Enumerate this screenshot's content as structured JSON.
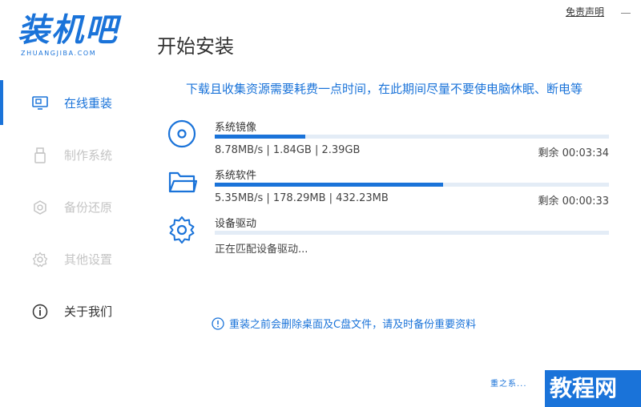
{
  "app": {
    "logo_text": "装机吧",
    "logo_sub": "ZHUANGJIBA.COM",
    "page_title": "开始安装",
    "disclaimer": "免责声明"
  },
  "sidebar": {
    "items": [
      {
        "label": "在线重装",
        "icon": "monitor-icon"
      },
      {
        "label": "制作系统",
        "icon": "usb-icon"
      },
      {
        "label": "备份还原",
        "icon": "backup-icon"
      },
      {
        "label": "其他设置",
        "icon": "gear-icon"
      },
      {
        "label": "关于我们",
        "icon": "info-icon"
      }
    ]
  },
  "notice": "下载且收集资源需要耗费一点时间，在此期间尽量不要使电脑休眠、断电等",
  "downloads": [
    {
      "title": "系统镜像",
      "stats": "8.78MB/s | 1.84GB | 2.39GB",
      "remaining": "剩余 00:03:34",
      "progress": 0.23,
      "icon": "disc-icon"
    },
    {
      "title": "系统软件",
      "stats": "5.35MB/s | 178.29MB | 432.23MB",
      "remaining": "剩余 00:00:33",
      "progress": 0.58,
      "icon": "folder-icon"
    },
    {
      "title": "设备驱动",
      "stats": "正在匹配设备驱动...",
      "remaining": "",
      "progress": 0.0,
      "icon": "gear-icon"
    }
  ],
  "warning": "重装之前会删除桌面及C盘文件，请及时备份重要资料",
  "watermark": {
    "mark": "重之系...",
    "brand": "教程网"
  },
  "colors": {
    "accent": "#1a73d9",
    "inactive": "#c4c4c4",
    "track": "#e3ecf6"
  }
}
